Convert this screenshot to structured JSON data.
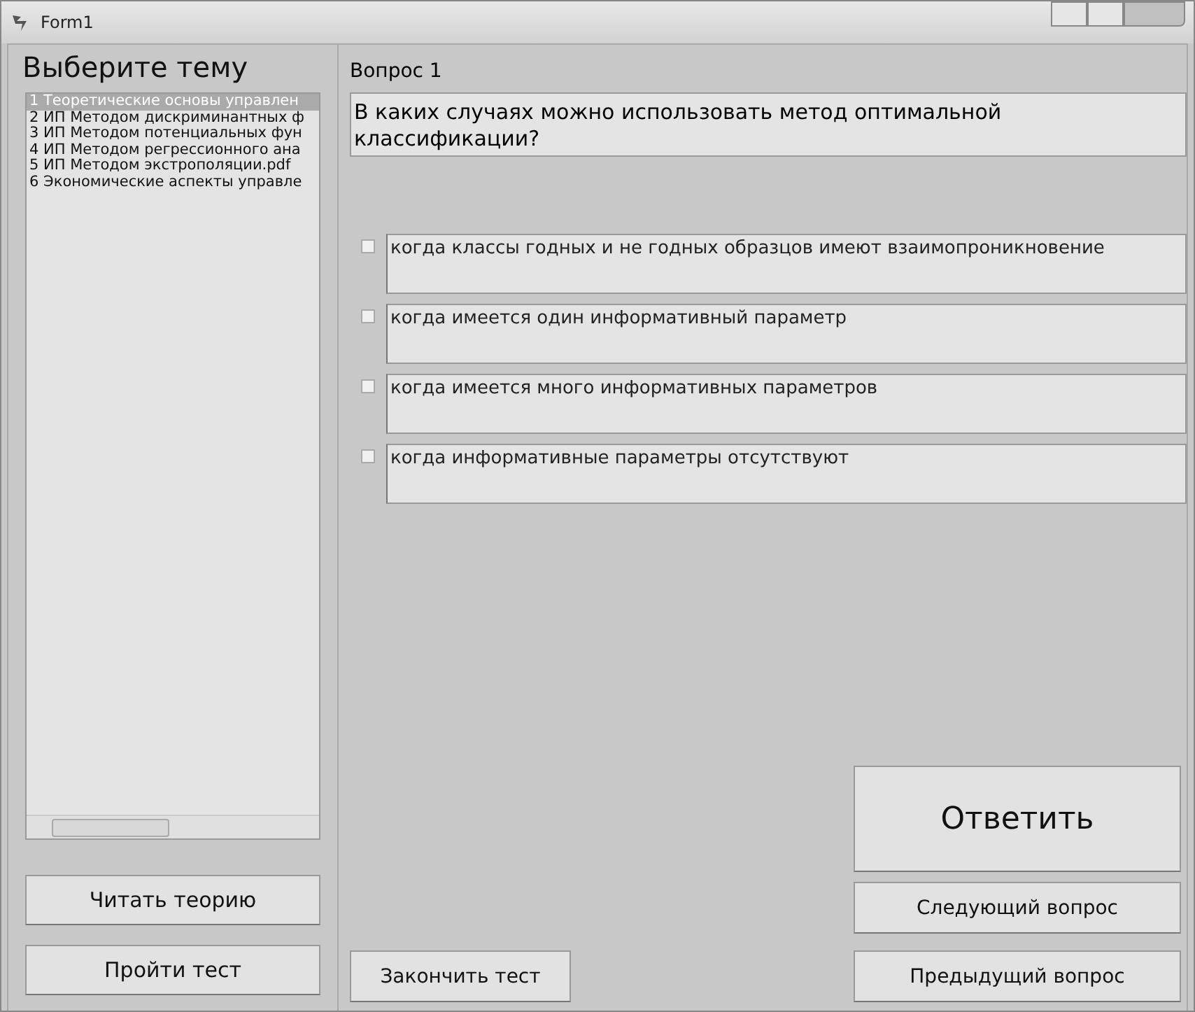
{
  "window": {
    "title": "Form1"
  },
  "topics": {
    "heading": "Выберите тему",
    "items": [
      {
        "label": "1 Теоретические основы управлен",
        "selected": true
      },
      {
        "label": "2 ИП Методом дискриминантных ф",
        "selected": false
      },
      {
        "label": "3 ИП Методом потенциальных фун",
        "selected": false
      },
      {
        "label": "4 ИП Методом регрессионного ана",
        "selected": false
      },
      {
        "label": "5 ИП Методом экстрополяции.pdf",
        "selected": false
      },
      {
        "label": "6 Экономические аспекты управле",
        "selected": false
      }
    ]
  },
  "left_buttons": [
    "Читать теорию",
    "Пройти тест"
  ],
  "question": {
    "heading": "Вопрос 1",
    "text": "В каких случаях можно использовать метод оптимальной классификации?"
  },
  "options": [
    {
      "text": "когда классы годных и не годных образцов имеют взаимопроникновение",
      "checked": false
    },
    {
      "text": "когда имеется один информативный параметр",
      "checked": false
    },
    {
      "text": "когда имеется много информативных параметров",
      "checked": false
    },
    {
      "text": "когда информативные параметры отсутствуют",
      "checked": false
    }
  ],
  "answer_button": "Ответить",
  "next_button": "Следующий вопрос",
  "finish_button": "Закончить тест",
  "prev_button": "Предыдущий вопрос"
}
